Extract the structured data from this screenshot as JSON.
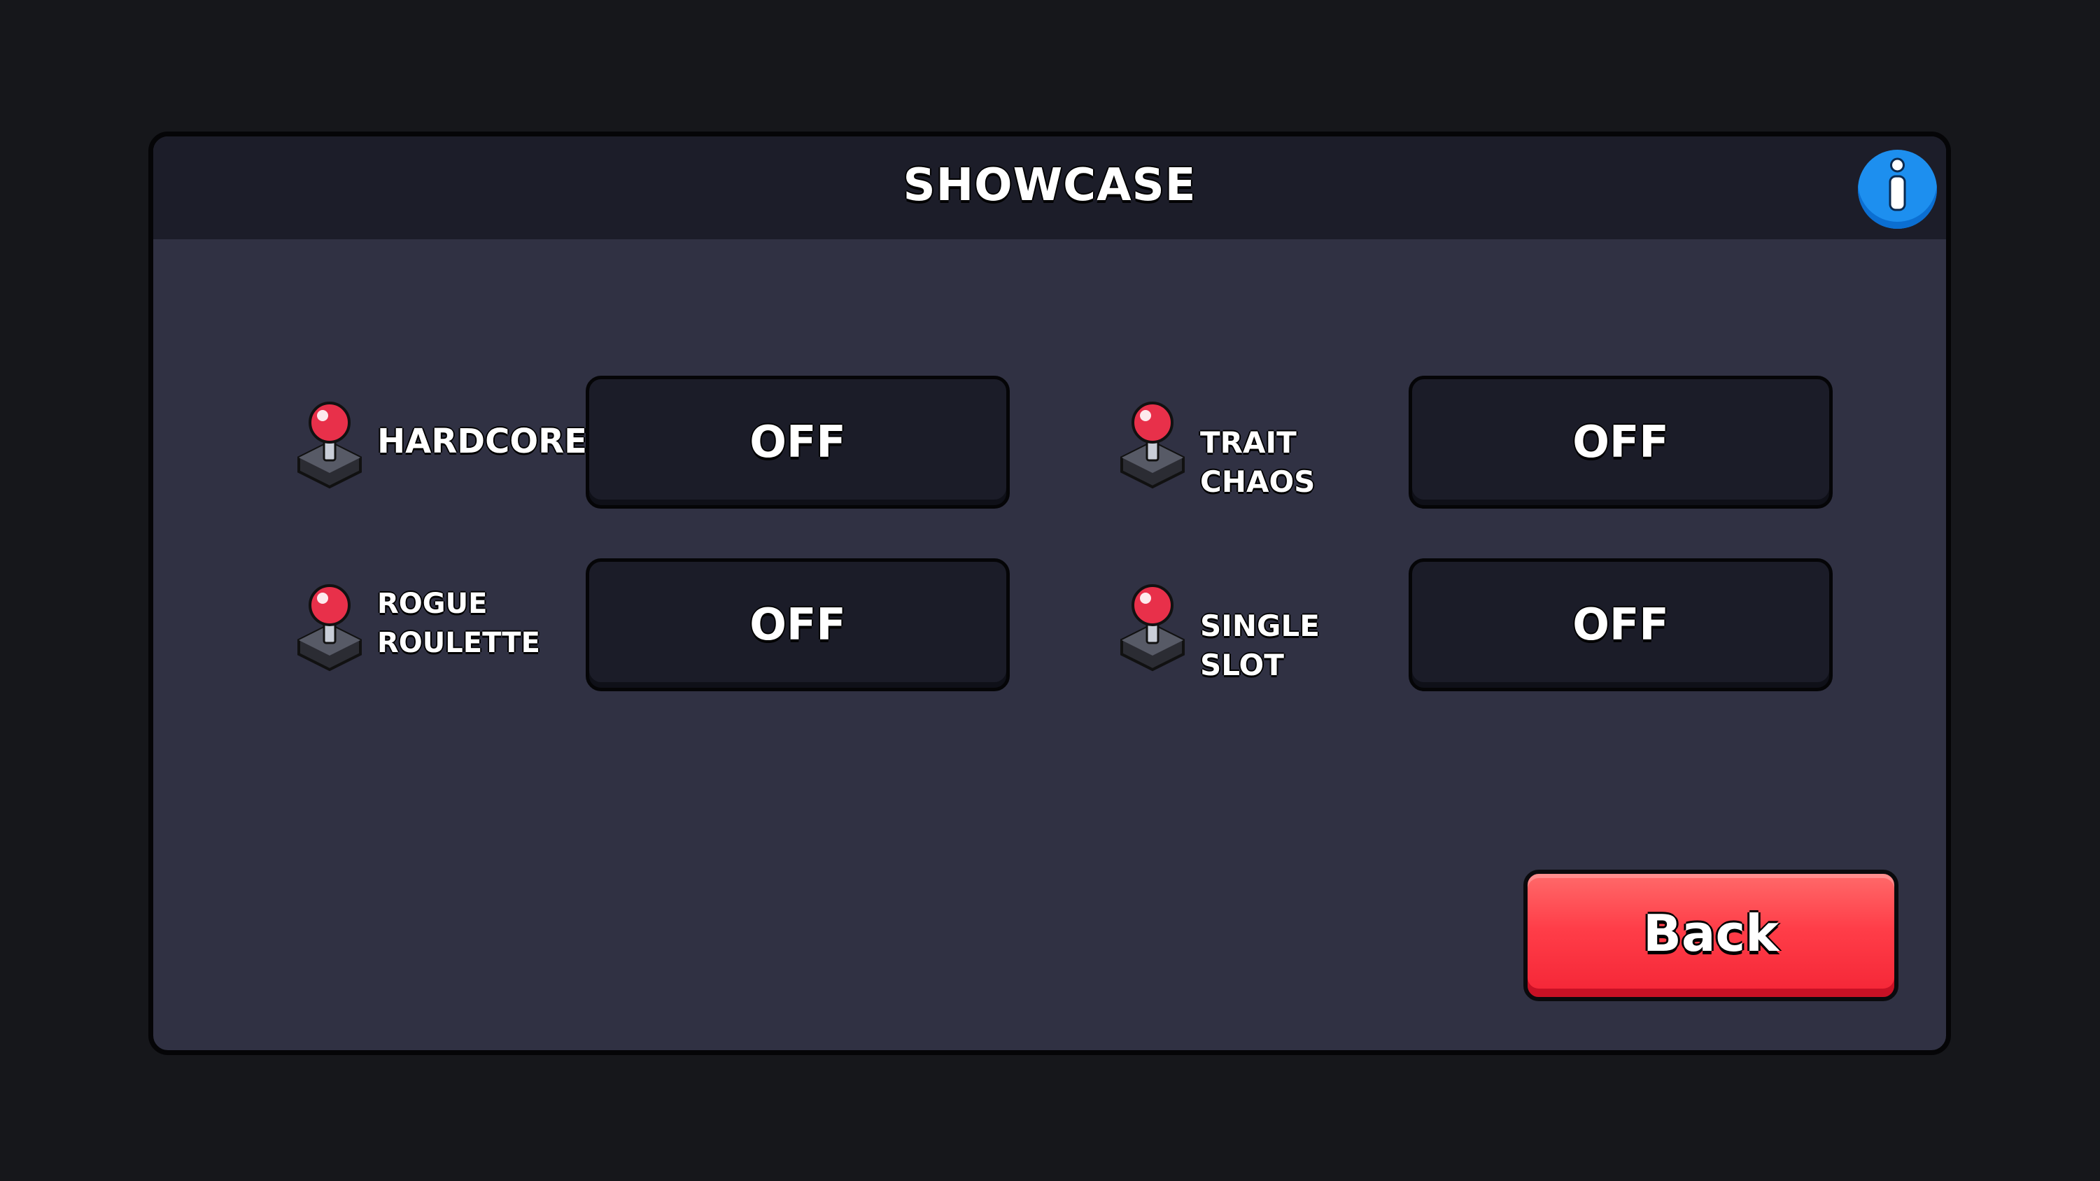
{
  "panel": {
    "title": "SHOWCASE",
    "info_icon": "info-icon"
  },
  "modes": [
    {
      "label": "HARDCORE",
      "value": "OFF",
      "icon": "joystick-icon"
    },
    {
      "label": "TRAIT CHAOS",
      "value": "OFF",
      "icon": "joystick-icon"
    },
    {
      "label": "ROGUE\nROULETTE",
      "value": "OFF",
      "icon": "joystick-icon"
    },
    {
      "label": "SINGLE SLOT",
      "value": "OFF",
      "icon": "joystick-icon"
    }
  ],
  "back_button": {
    "label": "Back"
  },
  "colors": {
    "background": "#16171b",
    "panel": "#303143",
    "header": "#1c1d29",
    "toggle": "#1b1c28",
    "back_button": "#ff3d48",
    "info_button": "#1d8fef",
    "joystick_ball": "#e8304a"
  }
}
